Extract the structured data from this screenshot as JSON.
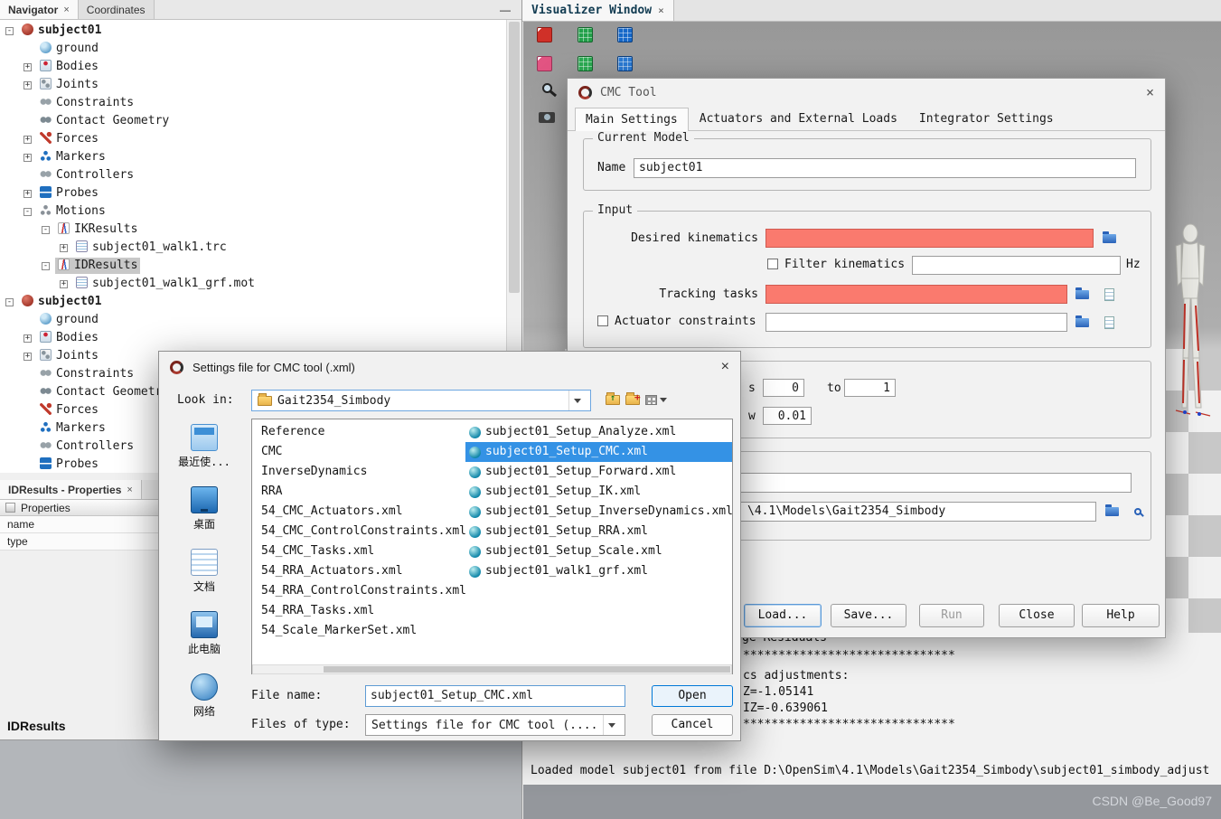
{
  "navigator": {
    "tab_active": "Navigator",
    "tab_close": "×",
    "tab_inactive": "Coordinates",
    "minimize": "—",
    "tree": [
      {
        "label": "subject01",
        "depth": 0,
        "expander": "minus",
        "icon": "model",
        "bold": true
      },
      {
        "label": "ground",
        "depth": 1,
        "expander": "none",
        "icon": "ground"
      },
      {
        "label": "Bodies",
        "depth": 1,
        "expander": "plus",
        "icon": "bodies"
      },
      {
        "label": "Joints",
        "depth": 1,
        "expander": "plus",
        "icon": "joints"
      },
      {
        "label": "Constraints",
        "depth": 1,
        "expander": "none",
        "icon": "constraints"
      },
      {
        "label": "Contact Geometry",
        "depth": 1,
        "expander": "none",
        "icon": "contact"
      },
      {
        "label": "Forces",
        "depth": 1,
        "expander": "plus",
        "icon": "forces"
      },
      {
        "label": "Markers",
        "depth": 1,
        "expander": "plus",
        "icon": "markers"
      },
      {
        "label": "Controllers",
        "depth": 1,
        "expander": "none",
        "icon": "controllers"
      },
      {
        "label": "Probes",
        "depth": 1,
        "expander": "plus",
        "icon": "probes"
      },
      {
        "label": "Motions",
        "depth": 1,
        "expander": "minus",
        "icon": "motions"
      },
      {
        "label": "IKResults",
        "depth": 2,
        "expander": "minus",
        "icon": "motion"
      },
      {
        "label": "subject01_walk1.trc",
        "depth": 3,
        "expander": "plus",
        "icon": "file"
      },
      {
        "label": "IDResults",
        "depth": 2,
        "expander": "minus",
        "icon": "motion",
        "selected": true
      },
      {
        "label": "subject01_walk1_grf.mot",
        "depth": 3,
        "expander": "plus",
        "icon": "file"
      },
      {
        "label": "subject01",
        "depth": 0,
        "expander": "minus",
        "icon": "model",
        "bold": true
      },
      {
        "label": "ground",
        "depth": 1,
        "expander": "none",
        "icon": "ground"
      },
      {
        "label": "Bodies",
        "depth": 1,
        "expander": "plus",
        "icon": "bodies"
      },
      {
        "label": "Joints",
        "depth": 1,
        "expander": "plus",
        "icon": "joints"
      },
      {
        "label": "Constraints",
        "depth": 1,
        "expander": "none",
        "icon": "constraints"
      },
      {
        "label": "Contact Geometry",
        "depth": 1,
        "expander": "none",
        "icon": "contact"
      },
      {
        "label": "Forces",
        "depth": 1,
        "expander": "none",
        "icon": "forces"
      },
      {
        "label": "Markers",
        "depth": 1,
        "expander": "none",
        "icon": "markers"
      },
      {
        "label": "Controllers",
        "depth": 1,
        "expander": "none",
        "icon": "controllers"
      },
      {
        "label": "Probes",
        "depth": 1,
        "expander": "none",
        "icon": "probes"
      }
    ]
  },
  "properties": {
    "tab_label": "IDResults - Properties",
    "tab_close": "×",
    "header": "Properties",
    "row1": "name",
    "row2": "type",
    "selection_label": "IDResults"
  },
  "visualizer": {
    "tab_label": "Visualizer Window",
    "tab_close": "×"
  },
  "cmc": {
    "title": "CMC Tool",
    "close": "×",
    "tabs": [
      "Main Settings",
      "Actuators and External Loads",
      "Integrator Settings"
    ],
    "current_model_legend": "Current Model",
    "name_label": "Name",
    "name_value": "subject01",
    "input_legend": "Input",
    "desired_kinematics_label": "Desired kinematics",
    "filter_kinematics_label": "Filter kinematics",
    "hz_label": "Hz",
    "tracking_tasks_label": "Tracking tasks",
    "actuator_constraints_label": "Actuator constraints",
    "time_label_fragment_1": "s",
    "time_from": "0",
    "time_to_label": "to",
    "time_to": "1",
    "time_label_fragment_2": "w",
    "time_window": "0.01",
    "directory_fragment": "\\4.1\\Models\\Gait2354_Simbody",
    "buttons": {
      "load": "Load...",
      "save": "Save...",
      "run": "Run",
      "close": "Close",
      "help": "Help"
    }
  },
  "file_dialog": {
    "title": "Settings file for CMC tool (.xml)",
    "close": "×",
    "look_in_label": "Look in:",
    "look_in_value": "Gait2354_Simbody",
    "places": [
      "最近使...",
      "桌面",
      "文档",
      "此电脑",
      "网络"
    ],
    "list_col1": [
      "Reference",
      "CMC",
      "InverseDynamics",
      "RRA",
      "54_CMC_Actuators.xml",
      "54_CMC_ControlConstraints.xml",
      "54_CMC_Tasks.xml",
      "54_RRA_Actuators.xml",
      "54_RRA_ControlConstraints.xml",
      "54_RRA_Tasks.xml",
      "54_Scale_MarkerSet.xml"
    ],
    "list_col2": [
      "subject01_Setup_Analyze.xml",
      "subject01_Setup_CMC.xml",
      "subject01_Setup_Forward.xml",
      "subject01_Setup_IK.xml",
      "subject01_Setup_InverseDynamics.xml",
      "subject01_Setup_RRA.xml",
      "subject01_Setup_Scale.xml",
      "subject01_walk1_grf.xml"
    ],
    "selected_file": "subject01_Setup_CMC.xml",
    "file_name_label": "File name:",
    "file_name_value": "subject01_Setup_CMC.xml",
    "files_of_type_label": "Files of type:",
    "files_of_type_value": "Settings file for CMC tool (....",
    "open_label": "Open",
    "cancel_label": "Cancel"
  },
  "console": {
    "fragment_top": "ge Residuals",
    "stars1": "******************************",
    "line_adjustments": "cs adjustments:",
    "line_z": "Z=-1.05141",
    "line_iz": "IZ=-0.639061",
    "stars2": "******************************",
    "loaded_line": "Loaded model subject01 from file D:\\OpenSim\\4.1\\Models\\Gait2354_Simbody\\subject01_simbody_adjust"
  },
  "watermark": "CSDN @Be_Good97"
}
